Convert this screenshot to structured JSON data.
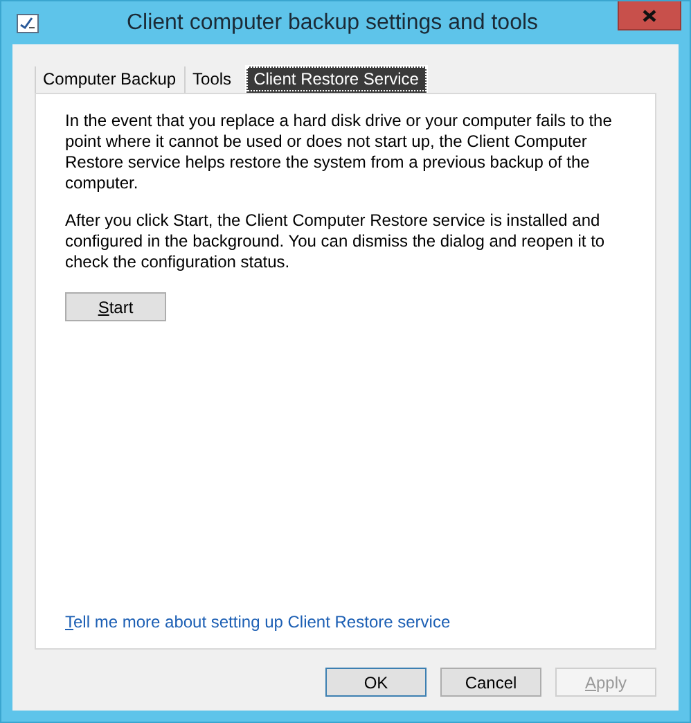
{
  "window": {
    "title": "Client computer backup settings and tools"
  },
  "tabs": [
    {
      "label": "Computer Backup",
      "selected": false
    },
    {
      "label": "Tools",
      "selected": false
    },
    {
      "label": "Client Restore Service",
      "selected": true
    }
  ],
  "paragraphs": [
    "In the event that you replace a hard disk drive or your computer fails to the point where it cannot be used or does not start up, the Client Computer Restore service helps restore the system from a previous backup of the computer.",
    "After you click Start, the Client Computer Restore service is installed and configured in the background. You can dismiss the dialog and reopen it to check the configuration status."
  ],
  "start_button": {
    "label": "Start",
    "mnemonic": true
  },
  "help_link": {
    "label": "Tell me more about setting up Client Restore service",
    "mnemonic": true
  },
  "buttons": [
    {
      "label": "OK",
      "disabled": false,
      "mnemonic": false,
      "default": true
    },
    {
      "label": "Cancel",
      "disabled": false,
      "mnemonic": false,
      "default": false
    },
    {
      "label": "Apply",
      "disabled": true,
      "mnemonic": true,
      "default": false
    }
  ]
}
